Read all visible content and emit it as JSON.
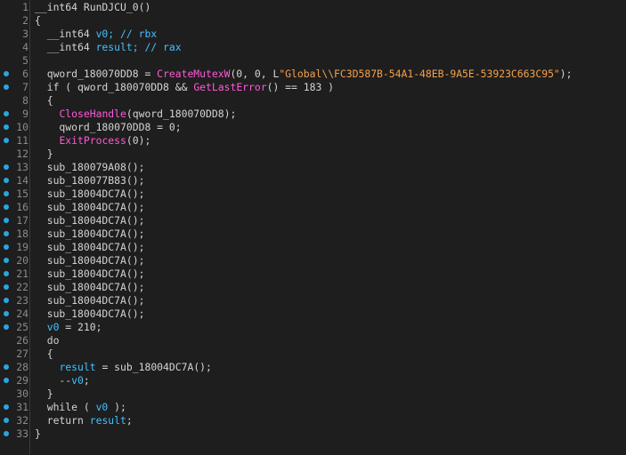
{
  "colors": {
    "background": "#1e1e1e",
    "text": "#d4d4d4",
    "line_number": "#8a8a8a",
    "breakpoint_dot": "#2aa7e0",
    "function_call": "#ff5ad7",
    "string": "#f5a14a",
    "variable": "#43c0ff"
  },
  "lines": [
    {
      "n": "1",
      "dot": false,
      "tokens": [
        {
          "t": "__int64 RunDJCU_0()",
          "c": "plain"
        }
      ]
    },
    {
      "n": "2",
      "dot": false,
      "tokens": [
        {
          "t": "{",
          "c": "plain"
        }
      ]
    },
    {
      "n": "3",
      "dot": false,
      "tokens": [
        {
          "t": "  __int64 ",
          "c": "plain"
        },
        {
          "t": "v0",
          "c": "var"
        },
        {
          "t": "; // rbx",
          "c": "cmt"
        }
      ]
    },
    {
      "n": "4",
      "dot": false,
      "tokens": [
        {
          "t": "  __int64 ",
          "c": "plain"
        },
        {
          "t": "result",
          "c": "var"
        },
        {
          "t": "; // rax",
          "c": "cmt"
        }
      ]
    },
    {
      "n": "5",
      "dot": false,
      "tokens": [
        {
          "t": "",
          "c": "plain"
        }
      ]
    },
    {
      "n": "6",
      "dot": true,
      "tokens": [
        {
          "t": "  qword_180070DD8 = ",
          "c": "plain"
        },
        {
          "t": "CreateMutexW",
          "c": "fn"
        },
        {
          "t": "(0, 0, L",
          "c": "plain"
        },
        {
          "t": "\"Global\\\\FC3D587B-54A1-48EB-9A5E-53923C663C95\"",
          "c": "str"
        },
        {
          "t": ");",
          "c": "plain"
        }
      ]
    },
    {
      "n": "7",
      "dot": true,
      "tokens": [
        {
          "t": "  if ( qword_180070DD8 && ",
          "c": "plain"
        },
        {
          "t": "GetLastError",
          "c": "fn"
        },
        {
          "t": "() == 183 )",
          "c": "plain"
        }
      ]
    },
    {
      "n": "8",
      "dot": false,
      "tokens": [
        {
          "t": "  {",
          "c": "plain"
        }
      ]
    },
    {
      "n": "9",
      "dot": true,
      "tokens": [
        {
          "t": "    ",
          "c": "plain"
        },
        {
          "t": "CloseHandle",
          "c": "fn"
        },
        {
          "t": "(qword_180070DD8);",
          "c": "plain"
        }
      ]
    },
    {
      "n": "10",
      "dot": true,
      "tokens": [
        {
          "t": "    qword_180070DD8 = 0;",
          "c": "plain"
        }
      ]
    },
    {
      "n": "11",
      "dot": true,
      "tokens": [
        {
          "t": "    ",
          "c": "plain"
        },
        {
          "t": "ExitProcess",
          "c": "fn"
        },
        {
          "t": "(0);",
          "c": "plain"
        }
      ]
    },
    {
      "n": "12",
      "dot": false,
      "tokens": [
        {
          "t": "  }",
          "c": "plain"
        }
      ]
    },
    {
      "n": "13",
      "dot": true,
      "tokens": [
        {
          "t": "  sub_180079A08();",
          "c": "plain"
        }
      ]
    },
    {
      "n": "14",
      "dot": true,
      "tokens": [
        {
          "t": "  sub_180077B83();",
          "c": "plain"
        }
      ]
    },
    {
      "n": "15",
      "dot": true,
      "tokens": [
        {
          "t": "  sub_18004DC7A();",
          "c": "plain"
        }
      ]
    },
    {
      "n": "16",
      "dot": true,
      "tokens": [
        {
          "t": "  sub_18004DC7A();",
          "c": "plain"
        }
      ]
    },
    {
      "n": "17",
      "dot": true,
      "tokens": [
        {
          "t": "  sub_18004DC7A();",
          "c": "plain"
        }
      ]
    },
    {
      "n": "18",
      "dot": true,
      "tokens": [
        {
          "t": "  sub_18004DC7A();",
          "c": "plain"
        }
      ]
    },
    {
      "n": "19",
      "dot": true,
      "tokens": [
        {
          "t": "  sub_18004DC7A();",
          "c": "plain"
        }
      ]
    },
    {
      "n": "20",
      "dot": true,
      "tokens": [
        {
          "t": "  sub_18004DC7A();",
          "c": "plain"
        }
      ]
    },
    {
      "n": "21",
      "dot": true,
      "tokens": [
        {
          "t": "  sub_18004DC7A();",
          "c": "plain"
        }
      ]
    },
    {
      "n": "22",
      "dot": true,
      "tokens": [
        {
          "t": "  sub_18004DC7A();",
          "c": "plain"
        }
      ]
    },
    {
      "n": "23",
      "dot": true,
      "tokens": [
        {
          "t": "  sub_18004DC7A();",
          "c": "plain"
        }
      ]
    },
    {
      "n": "24",
      "dot": true,
      "tokens": [
        {
          "t": "  sub_18004DC7A();",
          "c": "plain"
        }
      ]
    },
    {
      "n": "25",
      "dot": true,
      "tokens": [
        {
          "t": "  ",
          "c": "plain"
        },
        {
          "t": "v0",
          "c": "var"
        },
        {
          "t": " = 210;",
          "c": "plain"
        }
      ]
    },
    {
      "n": "26",
      "dot": false,
      "tokens": [
        {
          "t": "  do",
          "c": "plain"
        }
      ]
    },
    {
      "n": "27",
      "dot": false,
      "tokens": [
        {
          "t": "  {",
          "c": "plain"
        }
      ]
    },
    {
      "n": "28",
      "dot": true,
      "tokens": [
        {
          "t": "    ",
          "c": "plain"
        },
        {
          "t": "result",
          "c": "var"
        },
        {
          "t": " = sub_18004DC7A();",
          "c": "plain"
        }
      ]
    },
    {
      "n": "29",
      "dot": true,
      "tokens": [
        {
          "t": "    --",
          "c": "plain"
        },
        {
          "t": "v0",
          "c": "var"
        },
        {
          "t": ";",
          "c": "plain"
        }
      ]
    },
    {
      "n": "30",
      "dot": false,
      "tokens": [
        {
          "t": "  }",
          "c": "plain"
        }
      ]
    },
    {
      "n": "31",
      "dot": true,
      "tokens": [
        {
          "t": "  while ( ",
          "c": "plain"
        },
        {
          "t": "v0",
          "c": "var"
        },
        {
          "t": " );",
          "c": "plain"
        }
      ]
    },
    {
      "n": "32",
      "dot": true,
      "tokens": [
        {
          "t": "  return ",
          "c": "plain"
        },
        {
          "t": "result",
          "c": "var"
        },
        {
          "t": ";",
          "c": "plain"
        }
      ]
    },
    {
      "n": "33",
      "dot": true,
      "tokens": [
        {
          "t": "}",
          "c": "plain"
        }
      ]
    }
  ]
}
